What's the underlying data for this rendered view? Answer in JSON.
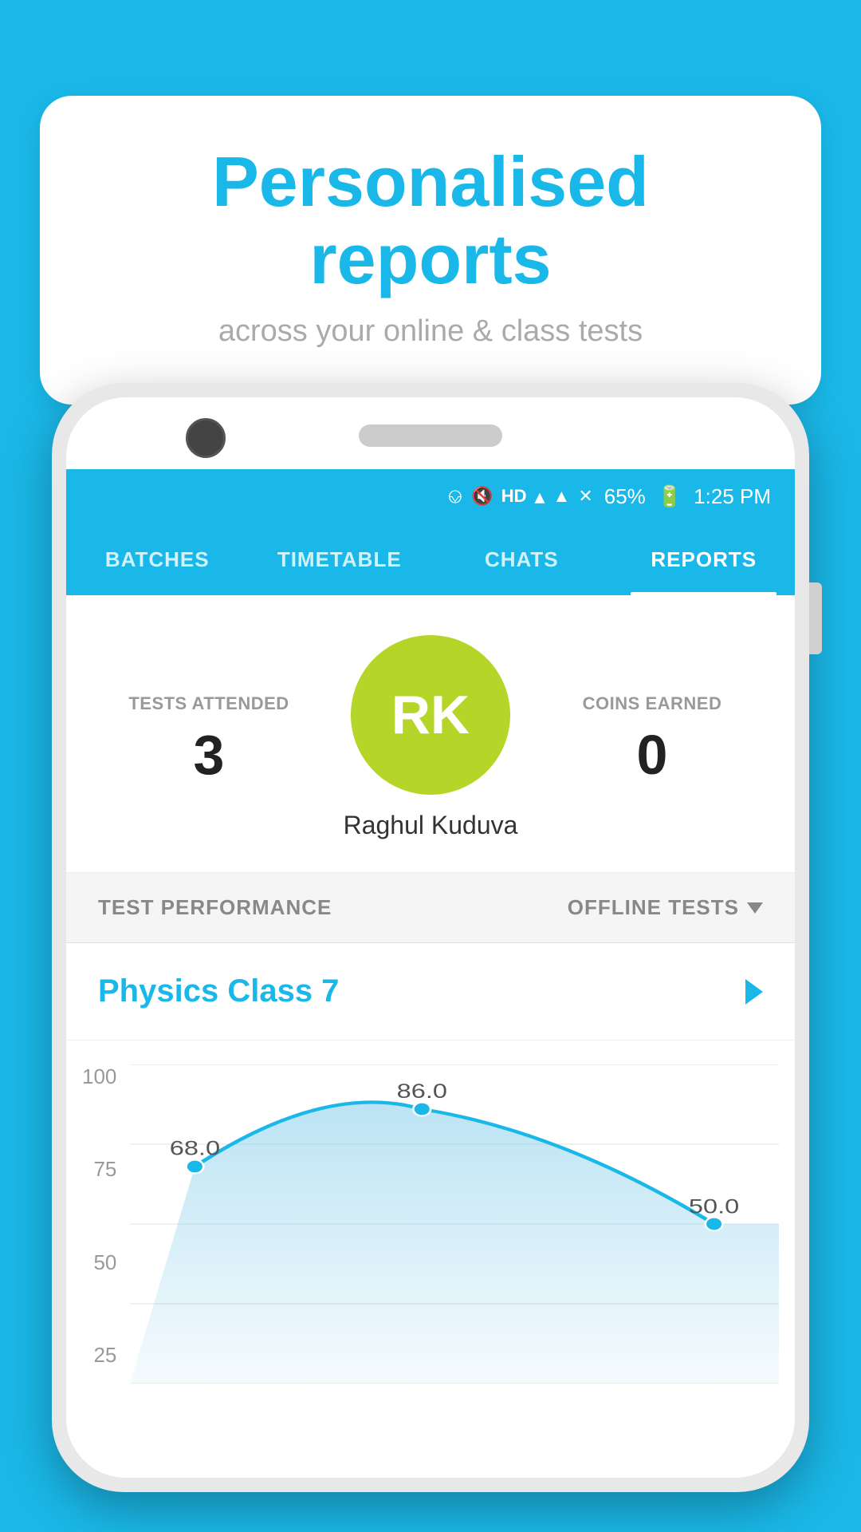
{
  "background_color": "#1ab8e8",
  "speech_bubble": {
    "title": "Personalised reports",
    "subtitle": "across your online & class tests"
  },
  "status_bar": {
    "battery": "65%",
    "time": "1:25 PM"
  },
  "nav_tabs": [
    {
      "id": "batches",
      "label": "BATCHES",
      "active": false
    },
    {
      "id": "timetable",
      "label": "TIMETABLE",
      "active": false
    },
    {
      "id": "chats",
      "label": "CHATS",
      "active": false
    },
    {
      "id": "reports",
      "label": "REPORTS",
      "active": true
    }
  ],
  "profile": {
    "avatar_initials": "RK",
    "avatar_bg": "#b5d629",
    "name": "Raghul Kuduva",
    "tests_attended_label": "TESTS ATTENDED",
    "tests_attended_value": "3",
    "coins_earned_label": "COINS EARNED",
    "coins_earned_value": "0"
  },
  "performance": {
    "section_label": "TEST PERFORMANCE",
    "filter_label": "OFFLINE TESTS",
    "class_name": "Physics Class 7",
    "chart": {
      "y_labels": [
        "100",
        "75",
        "50",
        "25"
      ],
      "data_points": [
        {
          "x": 0.1,
          "y": 68.0,
          "label": "68.0"
        },
        {
          "x": 0.45,
          "y": 86.0,
          "label": "86.0"
        },
        {
          "x": 0.9,
          "y": 50.0,
          "label": "50.0"
        }
      ]
    }
  }
}
